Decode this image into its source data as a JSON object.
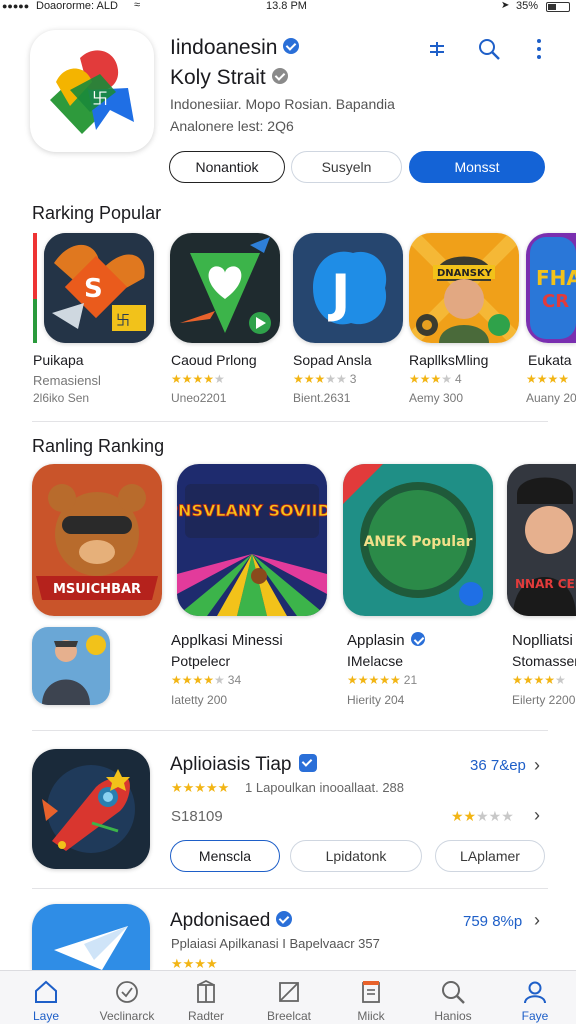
{
  "status_bar": {
    "signal": "●●●●●",
    "carrier": "Doaororme: ALD",
    "time": "13.8 PM",
    "battery": "35%"
  },
  "header_app": {
    "name": "Iindoanesin",
    "subtitle": "Koly Strait",
    "description": "Indonesiiar. Mopo Rosian. Bapandia",
    "description2": "Analonere lest: 2Q6",
    "buttons": [
      "Nonantiok",
      "Susyeln",
      "Monsst"
    ],
    "header_icons": [
      "filter-icon",
      "search-icon",
      "more-icon"
    ]
  },
  "section_popular": {
    "title": "Rarking Popular",
    "apps": [
      {
        "name": "Puikapa",
        "line2": "Remasiensl",
        "meta": "2l6iko Sen"
      },
      {
        "name": "Caoud Prlong",
        "rating": 4,
        "meta": "Uneo2201"
      },
      {
        "name": "Sopad Ansla",
        "rating": 2.5,
        "rating_text": "3",
        "meta": "Bient.2631"
      },
      {
        "name": "RapllksMling",
        "rating": 2.5,
        "rating_text": "4",
        "meta": "Aemy 300"
      },
      {
        "name": "Eukata",
        "rating": 5,
        "meta": "Auany 20"
      }
    ]
  },
  "section_ranking": {
    "title": "Ranling Ranking",
    "banners": [
      {
        "label": "MSUICHBAR"
      },
      {
        "label": "SOPNSVLANY SOVIIDAA!"
      },
      {
        "label": "ANEK Popular"
      },
      {
        "label": "NNAR CEF"
      }
    ],
    "apps": [
      {
        "name": "Applkasi Minessi",
        "line2": "Potpelecr",
        "rating": 4,
        "rating_text": "34",
        "meta": "Iatetty 200"
      },
      {
        "name": "Applasin",
        "line2": "IMelacse",
        "rating": 4.5,
        "rating_text": "21",
        "meta": "Hierity 204"
      },
      {
        "name": "Noplliatsi",
        "line2": "Stomasser",
        "rating": 4,
        "meta": "Eilerty 2200"
      }
    ]
  },
  "featured_rows": [
    {
      "title": "Aplioiasis Tiap",
      "subtitle": "1 Lapoulkan inooallaat. 288",
      "price_label": "36 7&ep",
      "price_sub": "S18109",
      "rating": 4.5,
      "rating2": 2,
      "buttons": [
        "Menscla",
        "Lpidatonk",
        "LAplamer"
      ]
    },
    {
      "title": "Apdonisaed",
      "subtitle": "Pplaiasi Apilkanasi I Bapelvaacr 357",
      "price_label": "759 8%p",
      "rating": 4
    }
  ],
  "tab_bar": {
    "tabs": [
      "Laye",
      "Veclinarck",
      "Radter",
      "Breelcat",
      "Miick",
      "Hanios",
      "Faye"
    ],
    "active_index": 6
  },
  "colors": {
    "accent": "#1463d6",
    "star": "#f2b515"
  }
}
